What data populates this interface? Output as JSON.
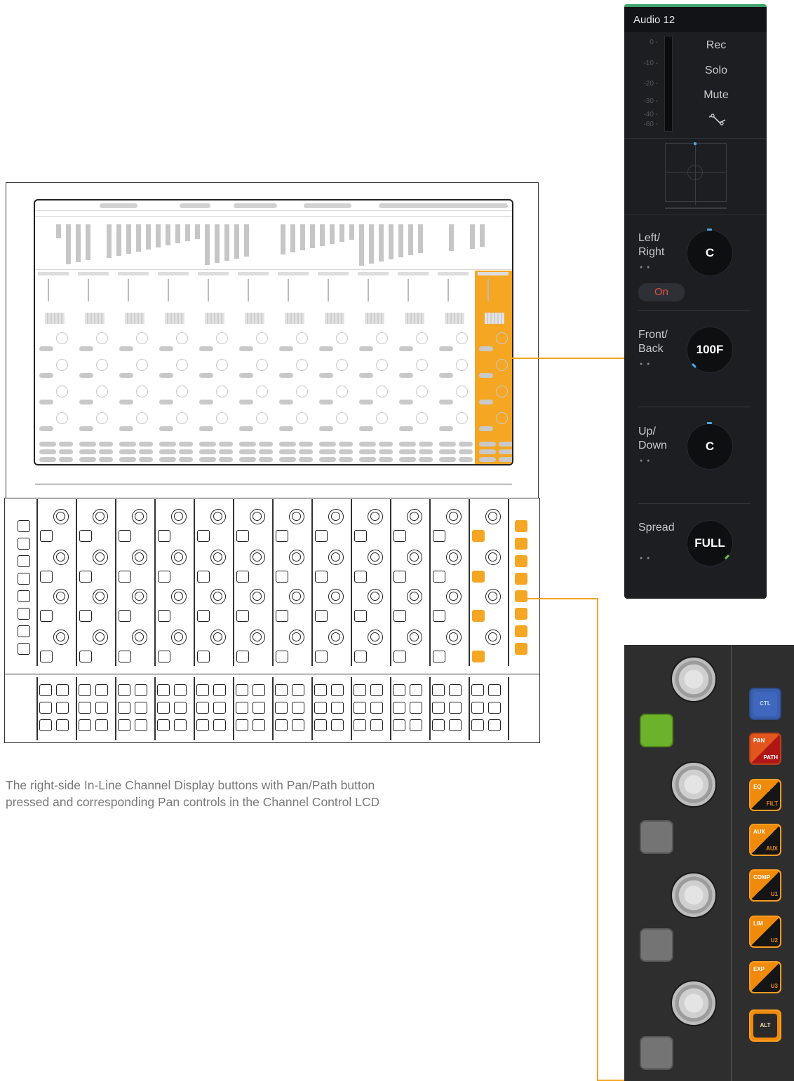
{
  "caption": {
    "line1": "The right-side In-Line Channel Display buttons with Pan/Path button",
    "line2": "pressed and corresponding Pan controls in the Channel Control LCD"
  },
  "channel_panel": {
    "title": "Audio 12",
    "meter_scale": [
      "0 -",
      "-10 -",
      "-20 -",
      "-30 -",
      "-40 -",
      "-60 -"
    ],
    "buttons": [
      "Rec",
      "Solo",
      "Mute"
    ],
    "automation_icon": "automation-curve-icon",
    "on_label": "On",
    "params": [
      {
        "label_1": "Left/",
        "label_2": "Right",
        "value": "C"
      },
      {
        "label_1": "Front/",
        "label_2": "Back",
        "value": "100F"
      },
      {
        "label_1": "Up/",
        "label_2": "Down",
        "value": "C"
      },
      {
        "label_1": "Spread",
        "label_2": "",
        "value": "FULL"
      }
    ],
    "page_dots": "● ●",
    "colors": {
      "accent_green": "#3fa36a",
      "value_tick_blue": "#4aa8e8",
      "on_red": "#e0524a",
      "spread_tick_green": "#6cc24a"
    }
  },
  "hardware_zoom": {
    "mode_buttons": [
      {
        "top": "",
        "bottom": "",
        "middle": "CTL"
      },
      {
        "top": "PAN",
        "bottom": "PATH",
        "middle": ""
      },
      {
        "top": "EQ",
        "bottom": "FILT",
        "middle": ""
      },
      {
        "top": "AUX",
        "bottom": "AUX",
        "middle": ""
      },
      {
        "top": "COMP",
        "bottom": "U1",
        "middle": ""
      },
      {
        "top": "LIM",
        "bottom": "U2",
        "middle": ""
      },
      {
        "top": "EXP",
        "bottom": "U3",
        "middle": ""
      },
      {
        "top": "",
        "bottom": "",
        "middle": "ALT"
      }
    ],
    "colors": {
      "orange": "#f08a0b",
      "blue": "#3a5fae",
      "green": "#6cb22a",
      "pan_red": "#e2561e"
    }
  },
  "colors": {
    "highlight_orange": "#f5a623"
  }
}
